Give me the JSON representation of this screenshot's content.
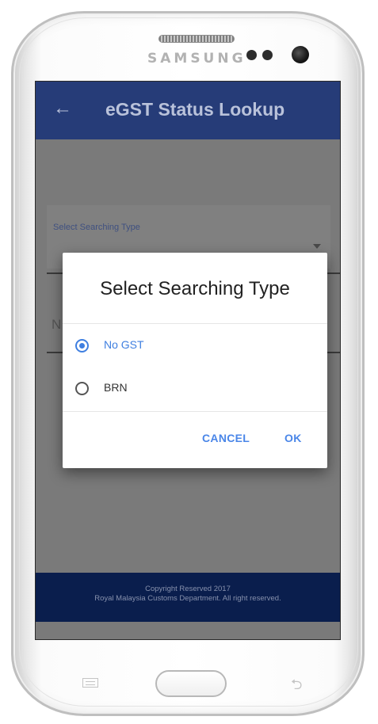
{
  "device": {
    "brand": "SAMSUNG"
  },
  "appbar": {
    "back_icon": "arrow-left-icon",
    "title": "eGST Status Lookup"
  },
  "form": {
    "search_type_label": "Select Searching Type",
    "input_peek": "N"
  },
  "dialog": {
    "title": "Select Searching Type",
    "options": [
      {
        "label": "No GST",
        "selected": true
      },
      {
        "label": "BRN",
        "selected": false
      }
    ],
    "cancel_label": "CANCEL",
    "ok_label": "OK"
  },
  "footer": {
    "line1": "Copyright Reserved 2017",
    "line2": "Royal Malaysia Customs Department. All right reserved."
  },
  "colors": {
    "appbar": "#263c78",
    "footer": "#0a1e4d",
    "accent": "#3f7fe0",
    "scrim": "#7a7a7a"
  }
}
